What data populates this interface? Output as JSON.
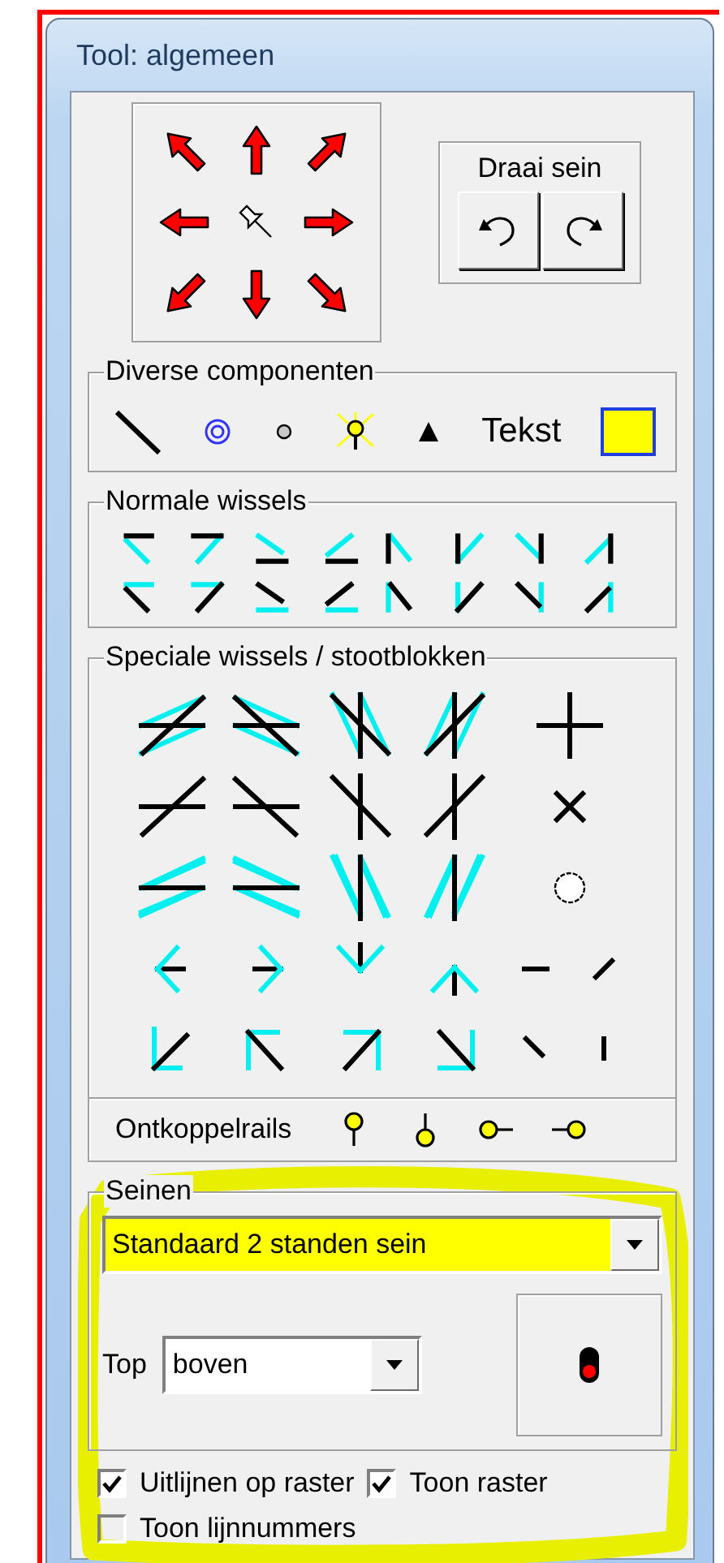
{
  "window": {
    "title": "Tool: algemeen"
  },
  "rotate_group": {
    "title": "Draai sein"
  },
  "components": {
    "title": "Diverse componenten",
    "text_label": "Tekst"
  },
  "normal_switches": {
    "title": "Normale wissels"
  },
  "special_switches": {
    "title": "Speciale wissels / stootblokken"
  },
  "uncouplers": {
    "label": "Ontkoppelrails"
  },
  "signals": {
    "title": "Seinen",
    "type": {
      "value": "Standaard 2 standen sein"
    },
    "top": {
      "label": "Top",
      "value": "boven"
    }
  },
  "options": [
    {
      "label": "Uitlijnen op raster",
      "checked": true
    },
    {
      "label": "Toon raster",
      "checked": true
    },
    {
      "label": "Toon lijnnummers",
      "checked": false
    }
  ]
}
